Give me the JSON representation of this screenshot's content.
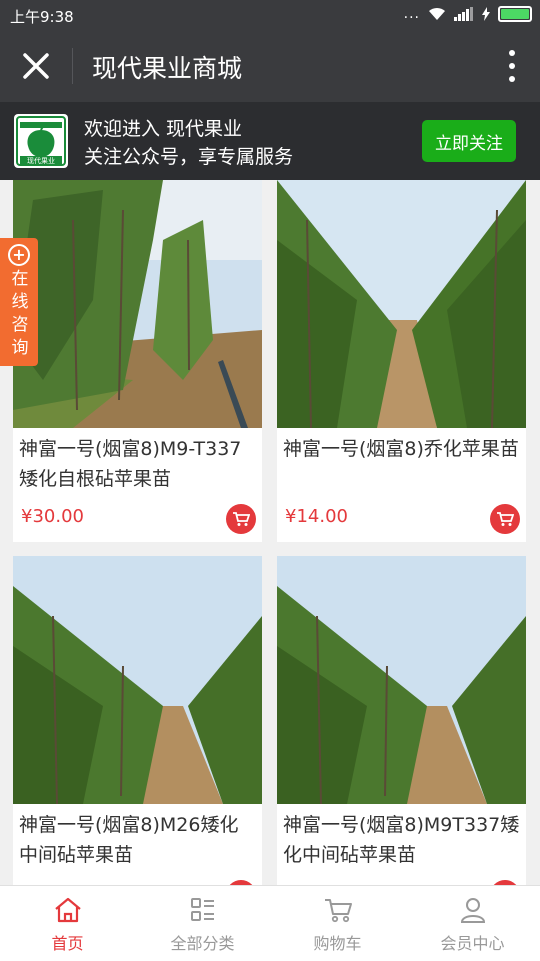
{
  "status_bar": {
    "time": "上午9:38",
    "dots": "..."
  },
  "header": {
    "title": "现代果业商城"
  },
  "follow_banner": {
    "line1": "欢迎进入 现代果业",
    "line2": "关注公众号，享专属服务",
    "button": "立即关注",
    "logo_text": "现代果业"
  },
  "consult_tab": {
    "label": "在线咨询"
  },
  "products": [
    {
      "name": "神富一号(烟富8)M9-T337矮化自根砧苹果苗",
      "price": "¥30.00"
    },
    {
      "name": "神富一号(烟富8)乔化苹果苗",
      "price": "¥14.00"
    },
    {
      "name": "神富一号(烟富8)M26矮化中间砧苹果苗",
      "price": ""
    },
    {
      "name": "神富一号(烟富8)M9T337矮化中间砧苹果苗",
      "price": ""
    }
  ],
  "bottom_nav": [
    {
      "label": "首页",
      "icon": "home-icon",
      "active": true
    },
    {
      "label": "全部分类",
      "icon": "category-icon",
      "active": false
    },
    {
      "label": "购物车",
      "icon": "cart-icon",
      "active": false
    },
    {
      "label": "会员中心",
      "icon": "user-icon",
      "active": false
    }
  ],
  "colors": {
    "accent": "#e4393c",
    "follow": "#1aad19",
    "consult": "#f26c30",
    "header_bg": "#3a3b3e"
  }
}
